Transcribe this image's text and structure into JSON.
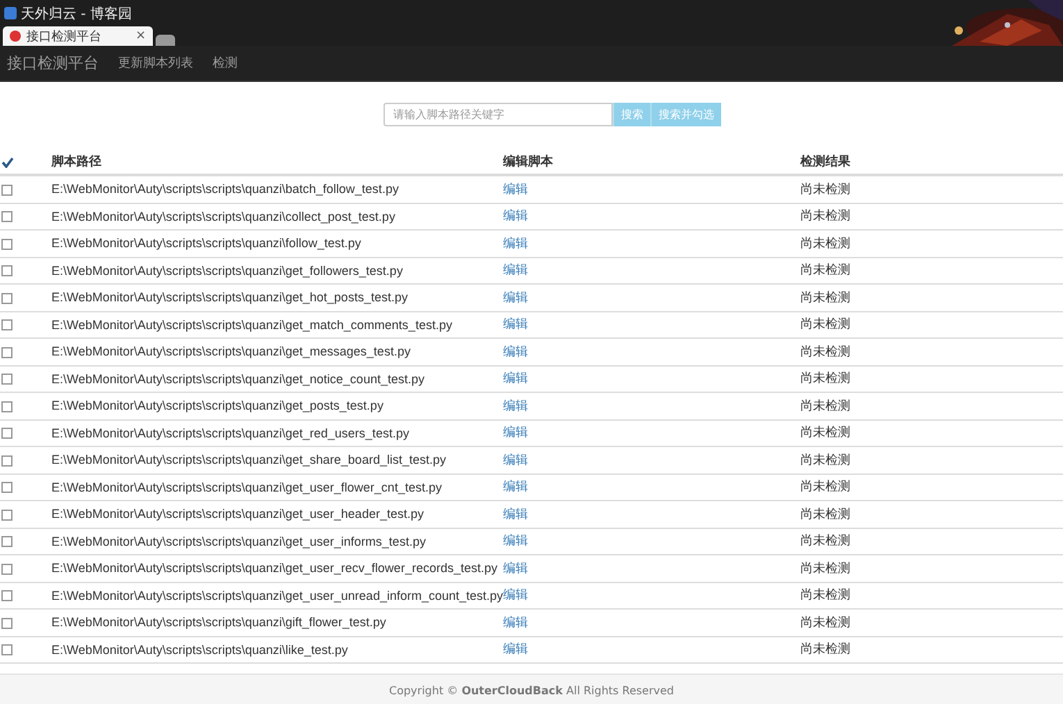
{
  "window": {
    "title": "天外归云 - 博客园"
  },
  "tabs": [
    {
      "kind": "page",
      "label": "接口检测平台",
      "close": "×",
      "selected": true
    },
    {
      "kind": "new",
      "selected": false
    }
  ],
  "navbar": {
    "brand": "接口检测平台",
    "items": [
      "更新脚本列表",
      "检测"
    ]
  },
  "search": {
    "placeholder": "请输入脚本路径关键字",
    "buttons": [
      "搜索",
      "搜索并勾选"
    ]
  },
  "table": {
    "select_all": {
      "checked": true
    },
    "columns": [
      "脚本路径",
      "编辑脚本",
      "检测结果"
    ],
    "rows": [
      {
        "checked": false,
        "path": "E:\\WebMonitor\\Auty\\scripts\\scripts\\quanzi\\batch_follow_test.py",
        "edit": "编辑",
        "result": "尚未检测"
      },
      {
        "checked": false,
        "path": "E:\\WebMonitor\\Auty\\scripts\\scripts\\quanzi\\collect_post_test.py",
        "edit": "编辑",
        "result": "尚未检测"
      },
      {
        "checked": false,
        "path": "E:\\WebMonitor\\Auty\\scripts\\scripts\\quanzi\\follow_test.py",
        "edit": "编辑",
        "result": "尚未检测"
      },
      {
        "checked": false,
        "path": "E:\\WebMonitor\\Auty\\scripts\\scripts\\quanzi\\get_followers_test.py",
        "edit": "编辑",
        "result": "尚未检测"
      },
      {
        "checked": false,
        "path": "E:\\WebMonitor\\Auty\\scripts\\scripts\\quanzi\\get_hot_posts_test.py",
        "edit": "编辑",
        "result": "尚未检测"
      },
      {
        "checked": false,
        "path": "E:\\WebMonitor\\Auty\\scripts\\scripts\\quanzi\\get_match_comments_test.py",
        "edit": "编辑",
        "result": "尚未检测"
      },
      {
        "checked": false,
        "path": "E:\\WebMonitor\\Auty\\scripts\\scripts\\quanzi\\get_messages_test.py",
        "edit": "编辑",
        "result": "尚未检测"
      },
      {
        "checked": false,
        "path": "E:\\WebMonitor\\Auty\\scripts\\scripts\\quanzi\\get_notice_count_test.py",
        "edit": "编辑",
        "result": "尚未检测"
      },
      {
        "checked": false,
        "path": "E:\\WebMonitor\\Auty\\scripts\\scripts\\quanzi\\get_posts_test.py",
        "edit": "编辑",
        "result": "尚未检测"
      },
      {
        "checked": false,
        "path": "E:\\WebMonitor\\Auty\\scripts\\scripts\\quanzi\\get_red_users_test.py",
        "edit": "编辑",
        "result": "尚未检测"
      },
      {
        "checked": false,
        "path": "E:\\WebMonitor\\Auty\\scripts\\scripts\\quanzi\\get_share_board_list_test.py",
        "edit": "编辑",
        "result": "尚未检测"
      },
      {
        "checked": false,
        "path": "E:\\WebMonitor\\Auty\\scripts\\scripts\\quanzi\\get_user_flower_cnt_test.py",
        "edit": "编辑",
        "result": "尚未检测"
      },
      {
        "checked": false,
        "path": "E:\\WebMonitor\\Auty\\scripts\\scripts\\quanzi\\get_user_header_test.py",
        "edit": "编辑",
        "result": "尚未检测"
      },
      {
        "checked": false,
        "path": "E:\\WebMonitor\\Auty\\scripts\\scripts\\quanzi\\get_user_informs_test.py",
        "edit": "编辑",
        "result": "尚未检测"
      },
      {
        "checked": false,
        "path": "E:\\WebMonitor\\Auty\\scripts\\scripts\\quanzi\\get_user_recv_flower_records_test.py",
        "edit": "编辑",
        "result": "尚未检测"
      },
      {
        "checked": false,
        "path": "E:\\WebMonitor\\Auty\\scripts\\scripts\\quanzi\\get_user_unread_inform_count_test.py",
        "edit": "编辑",
        "result": "尚未检测"
      },
      {
        "checked": false,
        "path": "E:\\WebMonitor\\Auty\\scripts\\scripts\\quanzi\\gift_flower_test.py",
        "edit": "编辑",
        "result": "尚未检测"
      },
      {
        "checked": false,
        "path": "E:\\WebMonitor\\Auty\\scripts\\scripts\\quanzi\\like_test.py",
        "edit": "编辑",
        "result": "尚未检测"
      }
    ]
  },
  "footer": {
    "text": "Copyright © **OuterCloudBack** All Rights Reserved"
  }
}
